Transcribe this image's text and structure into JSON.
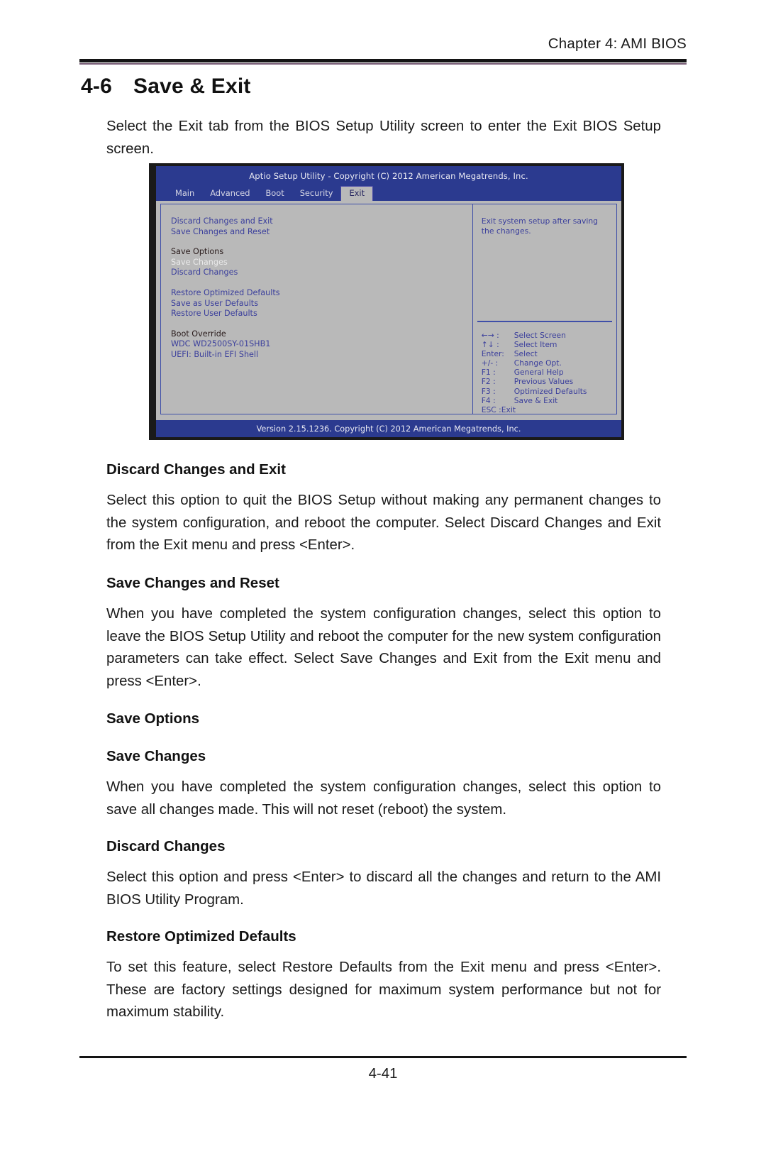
{
  "header": {
    "chapter_label": "Chapter 4: AMI BIOS"
  },
  "section": {
    "number": "4-6",
    "title": "Save & Exit",
    "intro": "Select the Exit tab from the BIOS Setup Utility screen to enter the Exit BIOS Setup screen."
  },
  "bios": {
    "title_bar": "Aptio Setup Utility - Copyright (C) 2012 American Megatrends, Inc.",
    "tabs": [
      {
        "label": "Main",
        "active": false
      },
      {
        "label": "Advanced",
        "active": false
      },
      {
        "label": "Boot",
        "active": false
      },
      {
        "label": "Security",
        "active": false
      },
      {
        "label": "Exit",
        "active": true
      }
    ],
    "menu": [
      {
        "label": "Discard Changes and Exit",
        "style": "item"
      },
      {
        "label": "Save Changes and Reset",
        "style": "item"
      },
      {
        "label": "Save Options",
        "style": "group"
      },
      {
        "label": "Save Changes",
        "style": "disabled"
      },
      {
        "label": "Discard Changes",
        "style": "item"
      },
      {
        "label": "Restore Optimized Defaults",
        "style": "item"
      },
      {
        "label": "Save as User Defaults",
        "style": "item"
      },
      {
        "label": "Restore User Defaults",
        "style": "item"
      },
      {
        "label": "Boot Override",
        "style": "group"
      },
      {
        "label": "WDC WD2500SY-01SHB1",
        "style": "item"
      },
      {
        "label": "UEFI: Built-in EFI Shell",
        "style": "item"
      }
    ],
    "help_text": "Exit system setup after saving the changes.",
    "keys": [
      {
        "key": "←→ :",
        "action": "Select Screen"
      },
      {
        "key": "↑↓  :",
        "action": "Select Item"
      },
      {
        "key": "Enter:",
        "action": "Select"
      },
      {
        "key": "+/-  :",
        "action": "Change Opt."
      },
      {
        "key": "F1 :",
        "action": "General Help"
      },
      {
        "key": "F2 :",
        "action": "Previous Values"
      },
      {
        "key": "F3 :",
        "action": "Optimized Defaults"
      },
      {
        "key": "F4 :",
        "action": "Save & Exit"
      },
      {
        "key": "ESC :",
        "action": "Exit"
      }
    ],
    "version_bar": "Version 2.15.1236. Copyright (C) 2012 American Megatrends, Inc."
  },
  "sections": [
    {
      "heading": "Discard Changes and Exit",
      "body": "Select this option to quit the BIOS Setup without making any permanent changes to the system configuration, and reboot the computer. Select Discard Changes and Exit from the Exit menu and press <Enter>."
    },
    {
      "heading": "Save Changes and Reset",
      "body": "When you have completed the system configuration changes, select this option to leave the BIOS Setup Utility and reboot the computer for the new system configuration parameters can take effect. Select Save Changes and Exit from the Exit menu and press <Enter>."
    },
    {
      "heading": "Save Options",
      "body": ""
    },
    {
      "heading": "Save Changes",
      "body": "When you have completed the system configuration changes, select this option to save all changes made. This will not reset (reboot) the system."
    },
    {
      "heading": "Discard Changes",
      "body": "Select this option and press <Enter> to discard all the changes and return to the AMI BIOS Utility Program."
    },
    {
      "heading": "Restore Optimized Defaults",
      "body": "To set this feature, select Restore Defaults from the Exit menu and press <Enter>. These are factory settings designed for maximum system performance but not for maximum stability."
    }
  ],
  "footer": {
    "page_number": "4-41"
  }
}
